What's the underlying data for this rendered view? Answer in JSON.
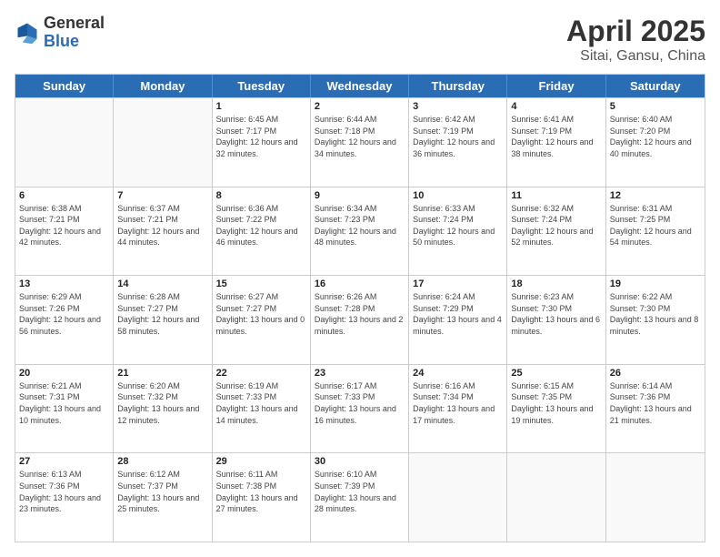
{
  "header": {
    "logo": {
      "general": "General",
      "blue": "Blue"
    },
    "title": "April 2025",
    "subtitle": "Sitai, Gansu, China"
  },
  "weekdays": [
    "Sunday",
    "Monday",
    "Tuesday",
    "Wednesday",
    "Thursday",
    "Friday",
    "Saturday"
  ],
  "weeks": [
    [
      {
        "day": "",
        "empty": true
      },
      {
        "day": "",
        "empty": true
      },
      {
        "day": "1",
        "sunrise": "Sunrise: 6:45 AM",
        "sunset": "Sunset: 7:17 PM",
        "daylight": "Daylight: 12 hours and 32 minutes."
      },
      {
        "day": "2",
        "sunrise": "Sunrise: 6:44 AM",
        "sunset": "Sunset: 7:18 PM",
        "daylight": "Daylight: 12 hours and 34 minutes."
      },
      {
        "day": "3",
        "sunrise": "Sunrise: 6:42 AM",
        "sunset": "Sunset: 7:19 PM",
        "daylight": "Daylight: 12 hours and 36 minutes."
      },
      {
        "day": "4",
        "sunrise": "Sunrise: 6:41 AM",
        "sunset": "Sunset: 7:19 PM",
        "daylight": "Daylight: 12 hours and 38 minutes."
      },
      {
        "day": "5",
        "sunrise": "Sunrise: 6:40 AM",
        "sunset": "Sunset: 7:20 PM",
        "daylight": "Daylight: 12 hours and 40 minutes."
      }
    ],
    [
      {
        "day": "6",
        "sunrise": "Sunrise: 6:38 AM",
        "sunset": "Sunset: 7:21 PM",
        "daylight": "Daylight: 12 hours and 42 minutes."
      },
      {
        "day": "7",
        "sunrise": "Sunrise: 6:37 AM",
        "sunset": "Sunset: 7:21 PM",
        "daylight": "Daylight: 12 hours and 44 minutes."
      },
      {
        "day": "8",
        "sunrise": "Sunrise: 6:36 AM",
        "sunset": "Sunset: 7:22 PM",
        "daylight": "Daylight: 12 hours and 46 minutes."
      },
      {
        "day": "9",
        "sunrise": "Sunrise: 6:34 AM",
        "sunset": "Sunset: 7:23 PM",
        "daylight": "Daylight: 12 hours and 48 minutes."
      },
      {
        "day": "10",
        "sunrise": "Sunrise: 6:33 AM",
        "sunset": "Sunset: 7:24 PM",
        "daylight": "Daylight: 12 hours and 50 minutes."
      },
      {
        "day": "11",
        "sunrise": "Sunrise: 6:32 AM",
        "sunset": "Sunset: 7:24 PM",
        "daylight": "Daylight: 12 hours and 52 minutes."
      },
      {
        "day": "12",
        "sunrise": "Sunrise: 6:31 AM",
        "sunset": "Sunset: 7:25 PM",
        "daylight": "Daylight: 12 hours and 54 minutes."
      }
    ],
    [
      {
        "day": "13",
        "sunrise": "Sunrise: 6:29 AM",
        "sunset": "Sunset: 7:26 PM",
        "daylight": "Daylight: 12 hours and 56 minutes."
      },
      {
        "day": "14",
        "sunrise": "Sunrise: 6:28 AM",
        "sunset": "Sunset: 7:27 PM",
        "daylight": "Daylight: 12 hours and 58 minutes."
      },
      {
        "day": "15",
        "sunrise": "Sunrise: 6:27 AM",
        "sunset": "Sunset: 7:27 PM",
        "daylight": "Daylight: 13 hours and 0 minutes."
      },
      {
        "day": "16",
        "sunrise": "Sunrise: 6:26 AM",
        "sunset": "Sunset: 7:28 PM",
        "daylight": "Daylight: 13 hours and 2 minutes."
      },
      {
        "day": "17",
        "sunrise": "Sunrise: 6:24 AM",
        "sunset": "Sunset: 7:29 PM",
        "daylight": "Daylight: 13 hours and 4 minutes."
      },
      {
        "day": "18",
        "sunrise": "Sunrise: 6:23 AM",
        "sunset": "Sunset: 7:30 PM",
        "daylight": "Daylight: 13 hours and 6 minutes."
      },
      {
        "day": "19",
        "sunrise": "Sunrise: 6:22 AM",
        "sunset": "Sunset: 7:30 PM",
        "daylight": "Daylight: 13 hours and 8 minutes."
      }
    ],
    [
      {
        "day": "20",
        "sunrise": "Sunrise: 6:21 AM",
        "sunset": "Sunset: 7:31 PM",
        "daylight": "Daylight: 13 hours and 10 minutes."
      },
      {
        "day": "21",
        "sunrise": "Sunrise: 6:20 AM",
        "sunset": "Sunset: 7:32 PM",
        "daylight": "Daylight: 13 hours and 12 minutes."
      },
      {
        "day": "22",
        "sunrise": "Sunrise: 6:19 AM",
        "sunset": "Sunset: 7:33 PM",
        "daylight": "Daylight: 13 hours and 14 minutes."
      },
      {
        "day": "23",
        "sunrise": "Sunrise: 6:17 AM",
        "sunset": "Sunset: 7:33 PM",
        "daylight": "Daylight: 13 hours and 16 minutes."
      },
      {
        "day": "24",
        "sunrise": "Sunrise: 6:16 AM",
        "sunset": "Sunset: 7:34 PM",
        "daylight": "Daylight: 13 hours and 17 minutes."
      },
      {
        "day": "25",
        "sunrise": "Sunrise: 6:15 AM",
        "sunset": "Sunset: 7:35 PM",
        "daylight": "Daylight: 13 hours and 19 minutes."
      },
      {
        "day": "26",
        "sunrise": "Sunrise: 6:14 AM",
        "sunset": "Sunset: 7:36 PM",
        "daylight": "Daylight: 13 hours and 21 minutes."
      }
    ],
    [
      {
        "day": "27",
        "sunrise": "Sunrise: 6:13 AM",
        "sunset": "Sunset: 7:36 PM",
        "daylight": "Daylight: 13 hours and 23 minutes."
      },
      {
        "day": "28",
        "sunrise": "Sunrise: 6:12 AM",
        "sunset": "Sunset: 7:37 PM",
        "daylight": "Daylight: 13 hours and 25 minutes."
      },
      {
        "day": "29",
        "sunrise": "Sunrise: 6:11 AM",
        "sunset": "Sunset: 7:38 PM",
        "daylight": "Daylight: 13 hours and 27 minutes."
      },
      {
        "day": "30",
        "sunrise": "Sunrise: 6:10 AM",
        "sunset": "Sunset: 7:39 PM",
        "daylight": "Daylight: 13 hours and 28 minutes."
      },
      {
        "day": "",
        "empty": true
      },
      {
        "day": "",
        "empty": true
      },
      {
        "day": "",
        "empty": true
      }
    ]
  ]
}
